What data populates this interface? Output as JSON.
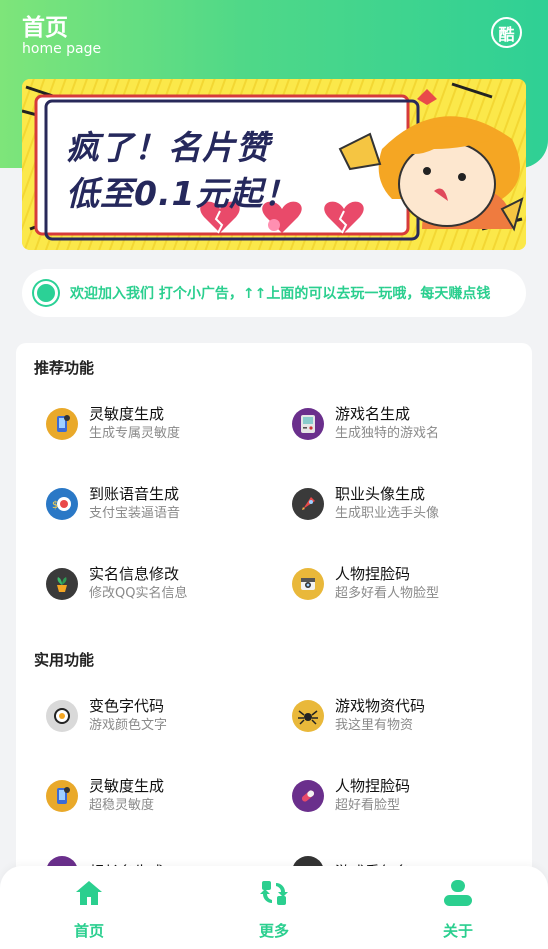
{
  "header": {
    "title": "首页",
    "subtitle": "home page",
    "cool_icon_text": "酷"
  },
  "banner": {
    "line1": "疯了！名片赞",
    "line2": "低至0.1元起！"
  },
  "notice": {
    "text": "欢迎加入我们  打个小广告，↑↑上面的可以去玩一玩哦，每天赚点钱"
  },
  "sections": {
    "recommended": {
      "title": "推荐功能",
      "items": [
        {
          "name": "灵敏度生成",
          "desc": "生成专属灵敏度",
          "icon": "phone-gear-icon"
        },
        {
          "name": "游戏名生成",
          "desc": "生成独特的游戏名",
          "icon": "gameboy-icon"
        },
        {
          "name": "到账语音生成",
          "desc": "支付宝装逼语音",
          "icon": "money-speaker-icon"
        },
        {
          "name": "职业头像生成",
          "desc": "生成职业选手头像",
          "icon": "rocket-icon"
        },
        {
          "name": "实名信息修改",
          "desc": "修改QQ实名信息",
          "icon": "plant-pot-icon"
        },
        {
          "name": "人物捏脸码",
          "desc": "超多好看人物脸型",
          "icon": "camera-icon"
        }
      ]
    },
    "practical": {
      "title": "实用功能",
      "items": [
        {
          "name": "变色字代码",
          "desc": "游戏颜色文字",
          "icon": "sushi-icon"
        },
        {
          "name": "游戏物资代码",
          "desc": "我这里有物资",
          "icon": "spider-icon"
        },
        {
          "name": "灵敏度生成",
          "desc": "超稳灵敏度",
          "icon": "phone-gear-icon"
        },
        {
          "name": "人物捏脸码",
          "desc": "超好看脸型",
          "icon": "pill-icon"
        },
        {
          "name": "超长名生成",
          "desc": "",
          "icon": "purple-icon"
        },
        {
          "name": "游戏重复名",
          "desc": "",
          "icon": "dark-icon"
        }
      ]
    }
  },
  "tabbar": {
    "tabs": [
      {
        "label": "首页",
        "icon": "home-icon"
      },
      {
        "label": "更多",
        "icon": "refresh-grid-icon"
      },
      {
        "label": "关于",
        "icon": "user-icon"
      }
    ]
  },
  "colors": {
    "accent": "#2bcf8f",
    "gradient_start": "#7ee57a",
    "gradient_end": "#2fd095"
  }
}
